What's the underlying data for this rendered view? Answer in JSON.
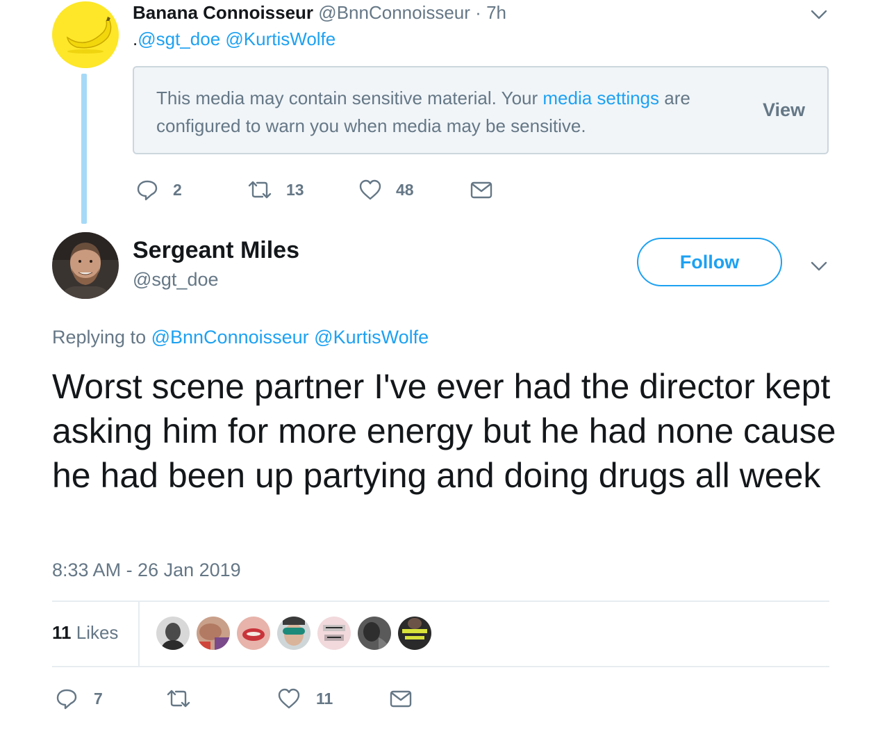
{
  "parent_tweet": {
    "author_name": "Banana Connoisseur",
    "author_handle": "@BnnConnoisseur",
    "separator": "·",
    "time": "7h",
    "text_prefix": ".",
    "mentions": [
      "@sgt_doe",
      "@KurtisWolfe"
    ],
    "sensitive_notice": {
      "text_before": "This media may contain sensitive material. Your ",
      "link_text": "media settings",
      "text_after": " are configured to warn you when media may be sensitive.",
      "view_label": "View"
    },
    "actions": {
      "replies": "2",
      "retweets": "13",
      "likes": "48"
    }
  },
  "main_tweet": {
    "author_name": "Sergeant Miles",
    "author_handle": "@sgt_doe",
    "follow_label": "Follow",
    "replying_label": "Replying to",
    "replying_to": [
      "@BnnConnoisseur",
      "@KurtisWolfe"
    ],
    "text": "Worst scene partner I've ever had the director kept asking him for more energy but he had none cause he had been up partying and doing drugs all week",
    "timestamp": "8:33 AM - 26 Jan 2019",
    "likes_count": "11",
    "likes_label": "Likes",
    "liker_avatar_count": 7,
    "actions": {
      "replies": "7",
      "retweets": "",
      "likes": "11"
    }
  },
  "colors": {
    "accent": "#1da1f2",
    "muted": "#657786",
    "thread_line": "#a6d9f7",
    "banana_avatar_bg": "#fde728",
    "divider": "#e6ecf0"
  },
  "icons": [
    "reply-icon",
    "retweet-icon",
    "heart-icon",
    "envelope-icon",
    "chevron-down-icon",
    "banana-icon"
  ]
}
